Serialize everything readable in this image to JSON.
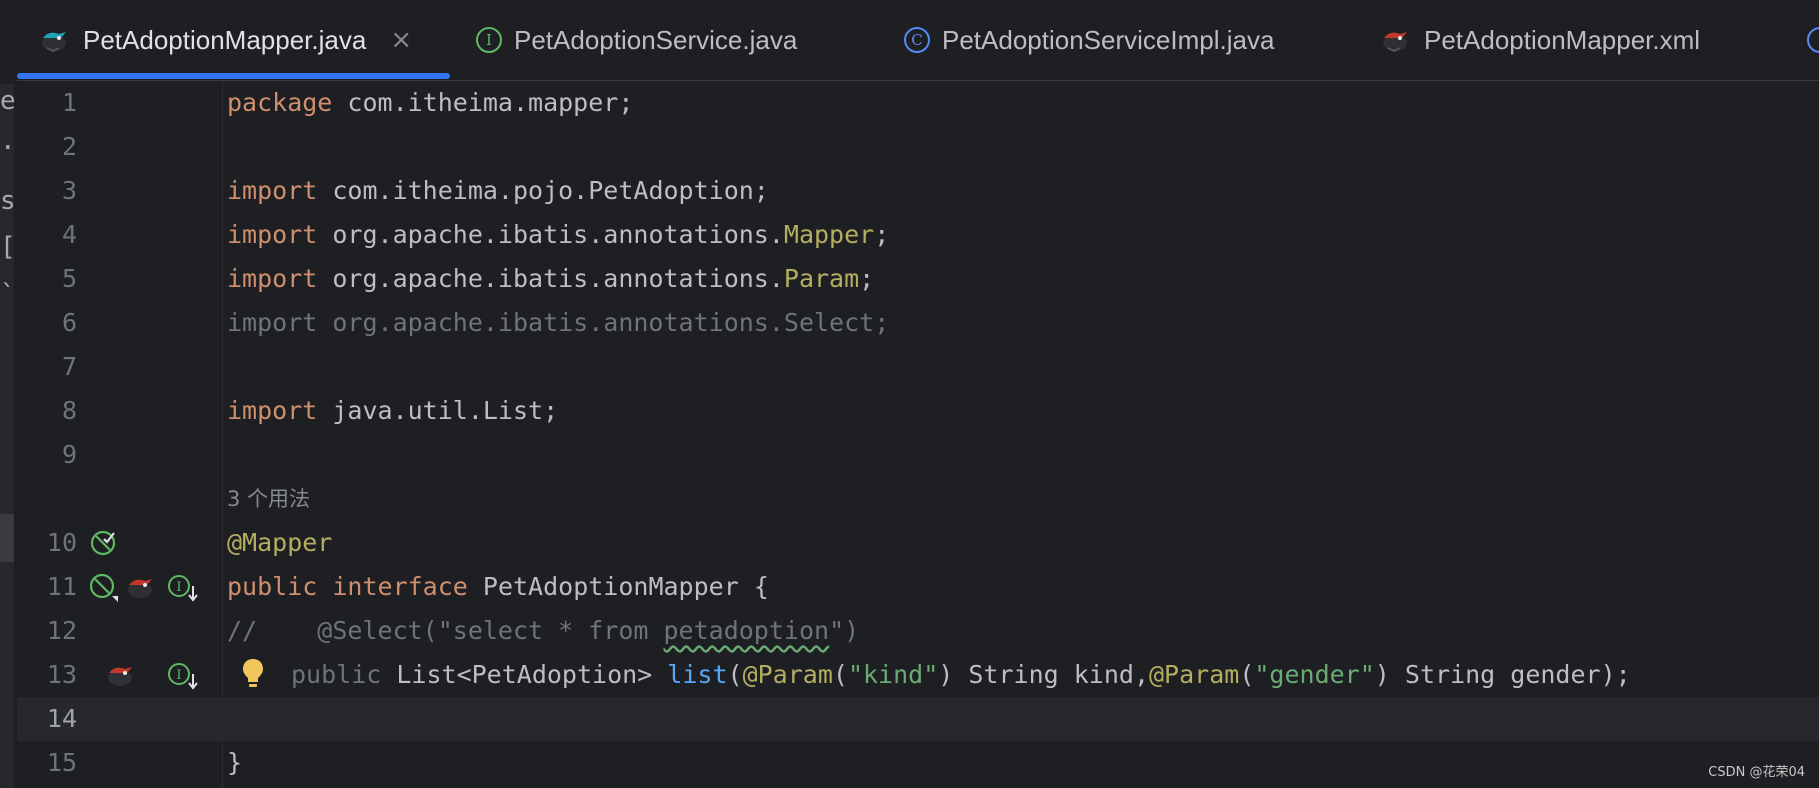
{
  "left_strip": {
    "fragments": [
      "et",
      ".",
      "s",
      "[",
      "`"
    ]
  },
  "tabs": [
    {
      "label": "PetAdoptionMapper.java",
      "icon": "mybatis-mapper-icon",
      "active": true,
      "close": "×"
    },
    {
      "label": "PetAdoptionService.java",
      "icon": "interface-icon",
      "glyph": "I"
    },
    {
      "label": "PetAdoptionServiceImpl.java",
      "icon": "class-icon",
      "glyph": "C"
    },
    {
      "label": "PetAdoptionMapper.xml",
      "icon": "mybatis-xml-icon"
    }
  ],
  "editor": {
    "line_numbers": [
      "1",
      "2",
      "3",
      "4",
      "5",
      "6",
      "7",
      "8",
      "9",
      "10",
      "11",
      "12",
      "13",
      "14",
      "15"
    ],
    "usage_hint": "3 个用法",
    "lines": {
      "l1": {
        "kw": "package",
        "rest": " com.itheima.mapper;"
      },
      "l3": {
        "kw": "import",
        "rest": " com.itheima.pojo.PetAdoption;"
      },
      "l4": {
        "kw": "import",
        "pkg": " org.apache.ibatis.annotations.",
        "name": "Mapper",
        "end": ";"
      },
      "l5": {
        "kw": "import",
        "pkg": " org.apache.ibatis.annotations.",
        "name": "Param",
        "end": ";"
      },
      "l6": {
        "text": "import org.apache.ibatis.annotations.Select;"
      },
      "l8": {
        "kw": "import",
        "rest": " java.util.List;"
      },
      "l10": {
        "ann": "@Mapper"
      },
      "l11": {
        "kw1": "public",
        "kw2": "interface",
        "name": " PetAdoptionMapper {"
      },
      "l12": {
        "prefix": "//    @Select(\"select * from ",
        "squiggle": "petadoption",
        "suffix": "\")"
      },
      "l13": {
        "kw": "public",
        "type": " List<PetAdoption> ",
        "fn": "list",
        "p_open": "(",
        "ann1": "@Param",
        "po1": "(",
        "str1": "\"kind\"",
        "pc1": ")",
        "mid": " String kind,",
        "ann2": "@Param",
        "po2": "(",
        "str2": "\"gender\"",
        "pc2": ")",
        "tail": " String gender);"
      },
      "l15": {
        "text": "}"
      }
    }
  },
  "colors": {
    "background": "#1e1f22",
    "keyword": "#cf8e6d",
    "annotation": "#b3ae60",
    "string": "#6aab73",
    "function": "#56a8f5",
    "tab_underline": "#3574f0"
  },
  "watermark": "CSDN @花荣04"
}
